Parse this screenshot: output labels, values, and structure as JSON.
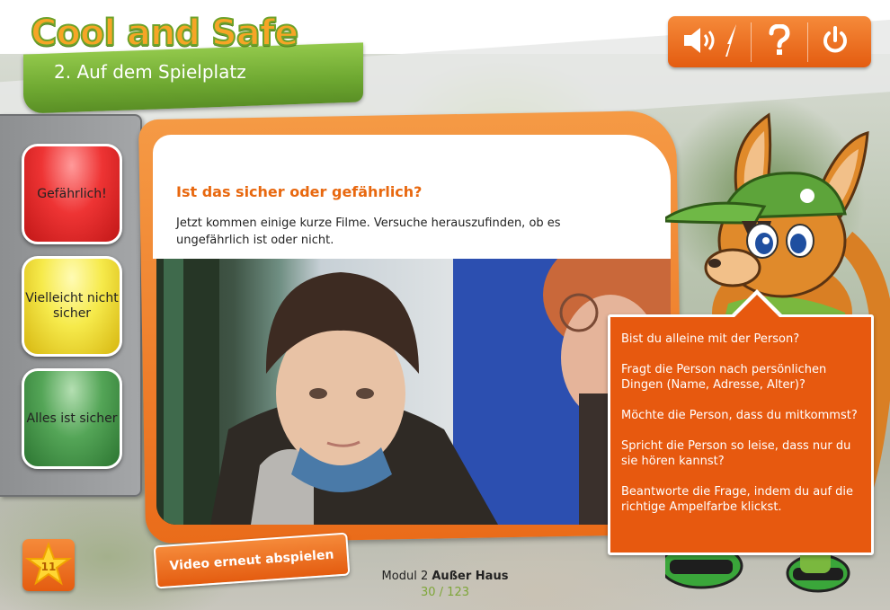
{
  "header": {
    "logo_text": "Cool and Safe",
    "section_title": "2. Auf dem Spielplatz"
  },
  "toolbar": {
    "icons": [
      "speaker-icon",
      "help-icon",
      "power-icon"
    ]
  },
  "traffic_lights": [
    {
      "label": "Gefährlich!",
      "color": "#e53935"
    },
    {
      "label": "Vielleicht nicht sicher",
      "color": "#f3e548"
    },
    {
      "label": "Alles ist sicher",
      "color": "#4a9b4e"
    }
  ],
  "content": {
    "title": "Ist das sicher oder gefährlich?",
    "text": "Jetzt kommen einige kurze Filme. Versuche herauszufinden, ob es ungefährlich ist oder nicht."
  },
  "bubble": {
    "questions": [
      "Bist du alleine mit der Person?",
      "Fragt die Person nach persönlichen Dingen (Name, Adresse, Alter)?",
      "Möchte die Person, dass du mitkommst?",
      "Spricht die Person so leise, dass nur du sie hören kannst?",
      "Beantworte die Frage, indem du auf die richtige Ampelfarbe klickst."
    ]
  },
  "replay_button": "Video erneut abspielen",
  "star_badge": {
    "count": "11"
  },
  "footer": {
    "module_prefix": "Modul 2",
    "module_name": "Außer Haus",
    "page_indicator": "30 / 123"
  },
  "colors": {
    "accent_orange": "#e8680f",
    "accent_green": "#6ea831"
  }
}
